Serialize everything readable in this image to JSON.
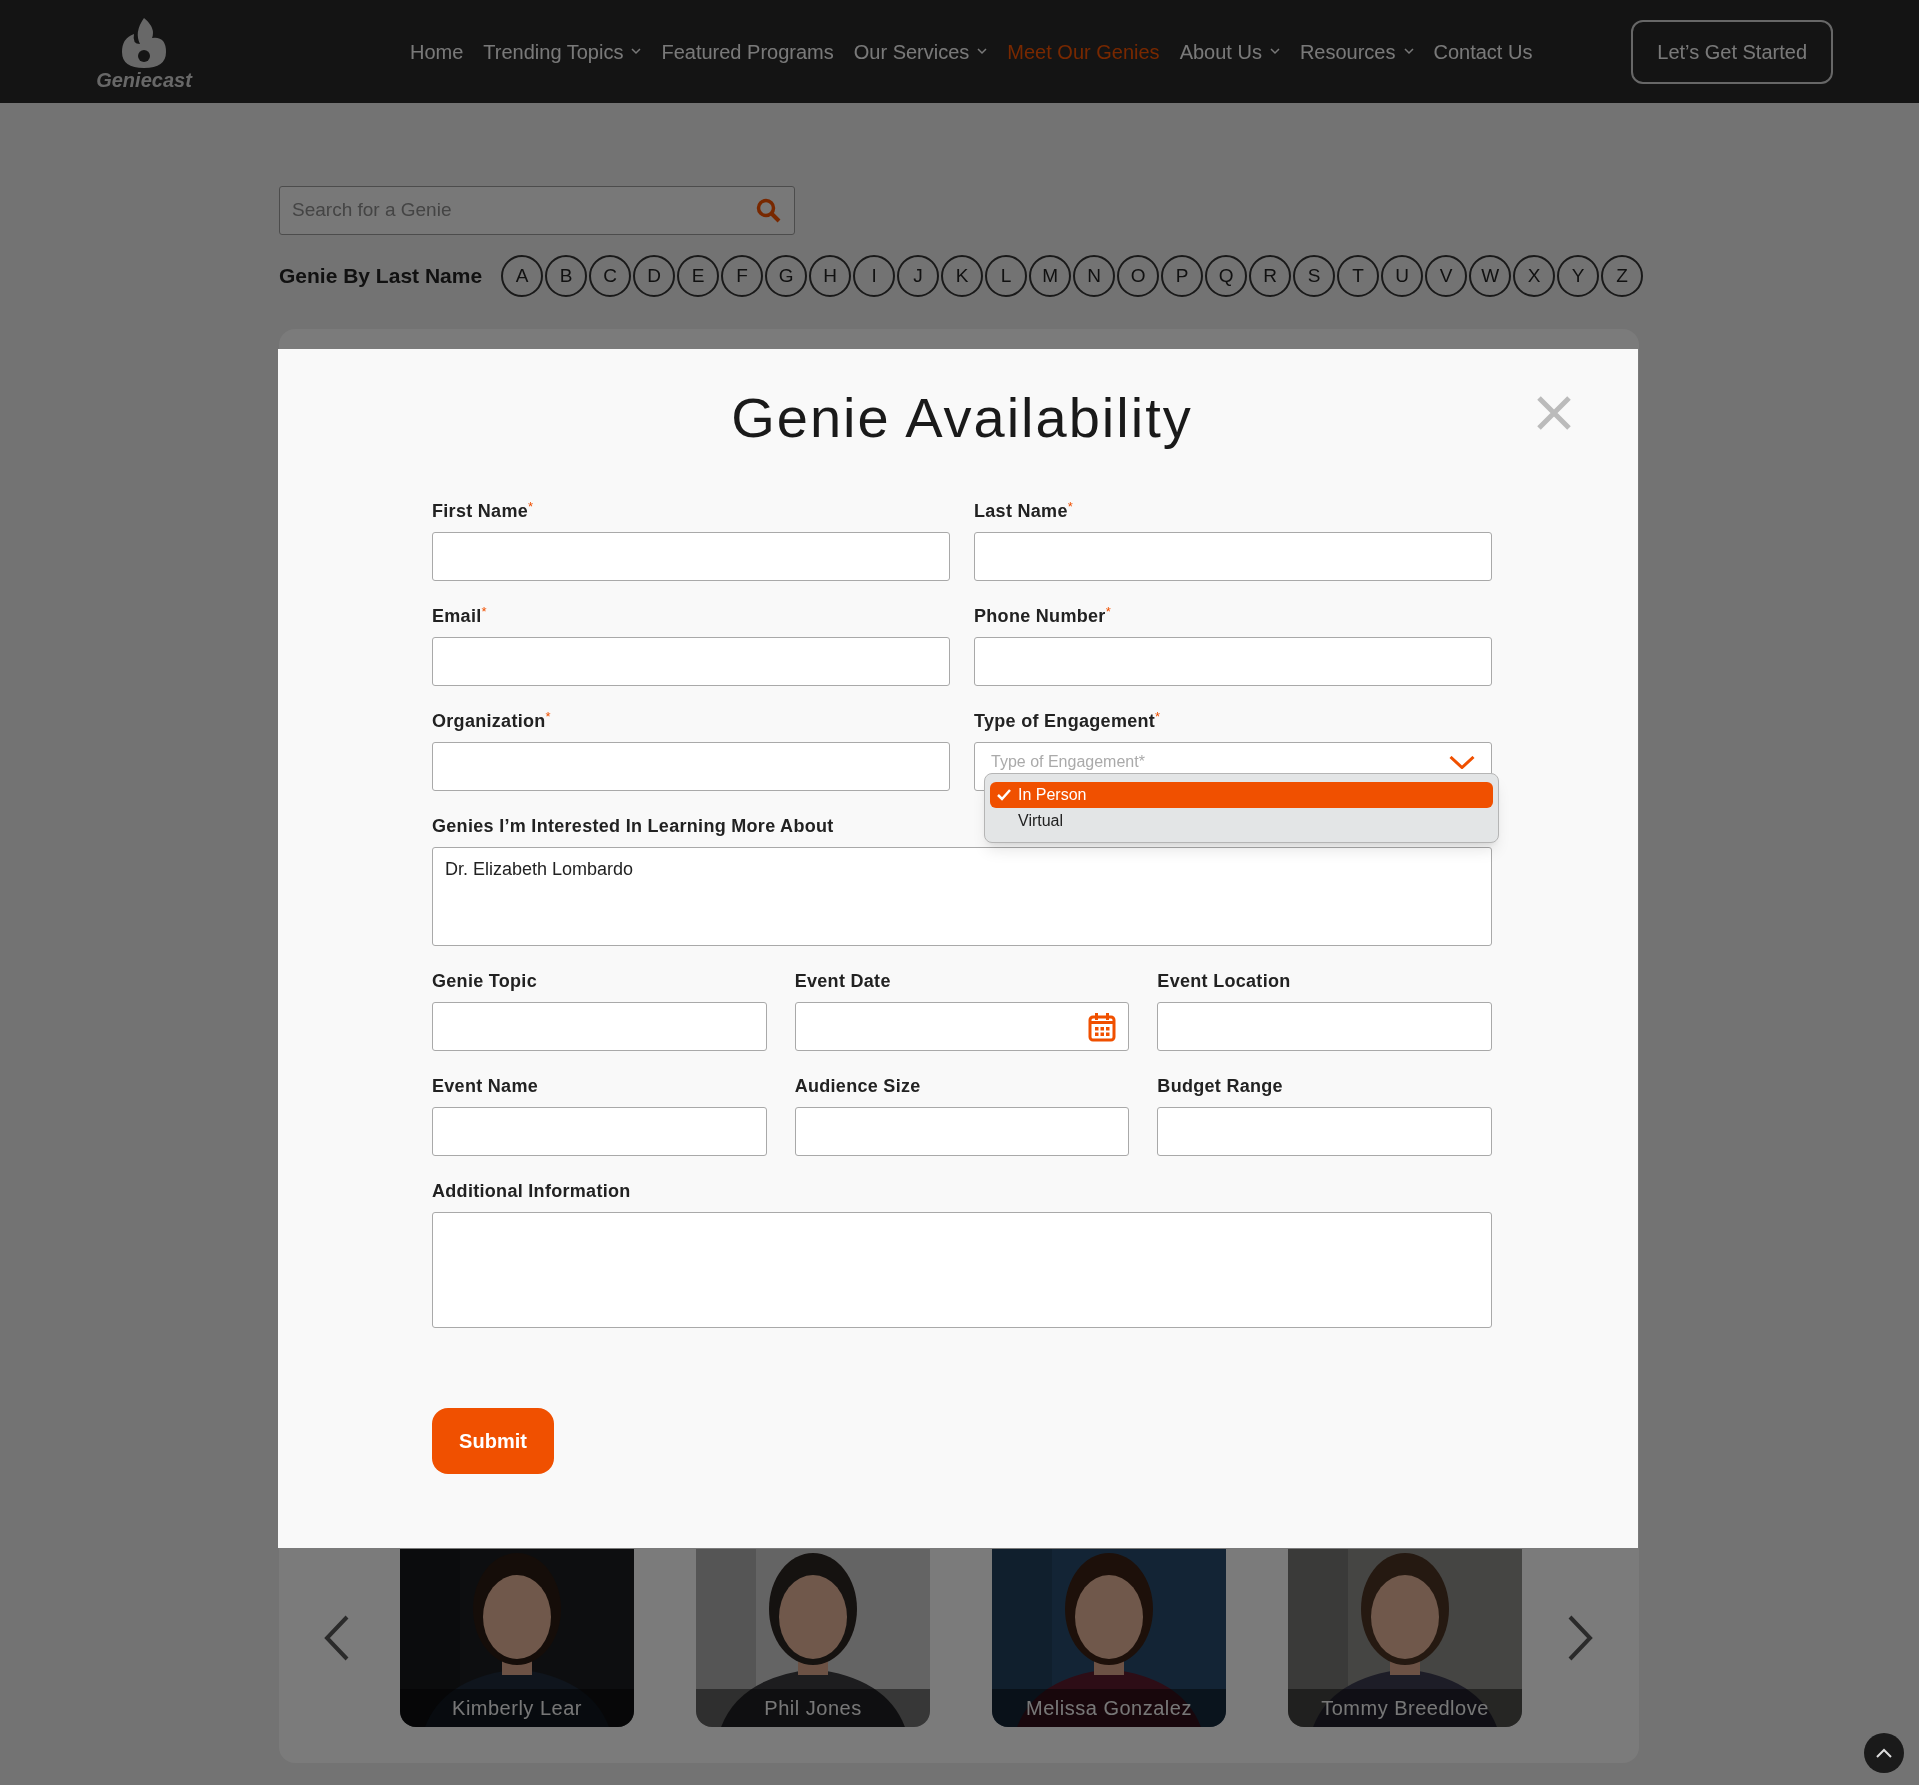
{
  "header": {
    "logo_text": "Geniecast",
    "nav": [
      {
        "label": "Home",
        "selected": false,
        "dropdown": false
      },
      {
        "label": "Trending Topics",
        "selected": false,
        "dropdown": true
      },
      {
        "label": "Featured Programs",
        "selected": false,
        "dropdown": false
      },
      {
        "label": "Our Services",
        "selected": false,
        "dropdown": true
      },
      {
        "label": "Meet Our Genies",
        "selected": true,
        "dropdown": false
      },
      {
        "label": "About Us",
        "selected": false,
        "dropdown": true
      },
      {
        "label": "Resources",
        "selected": false,
        "dropdown": true
      },
      {
        "label": "Contact Us",
        "selected": false,
        "dropdown": false
      }
    ],
    "cta": "Let’s Get Started"
  },
  "search": {
    "placeholder": "Search for a Genie"
  },
  "alphabet": {
    "label": "Genie By Last Name",
    "letters": [
      "A",
      "B",
      "C",
      "D",
      "E",
      "F",
      "G",
      "H",
      "I",
      "J",
      "K",
      "L",
      "M",
      "N",
      "O",
      "P",
      "Q",
      "R",
      "S",
      "T",
      "U",
      "V",
      "W",
      "X",
      "Y",
      "Z"
    ]
  },
  "modal": {
    "title": "Genie Availability",
    "rows": [
      [
        {
          "label": "First Name",
          "mark": "*",
          "kind": "text"
        },
        {
          "label": "Last Name",
          "mark": "*",
          "kind": "text"
        }
      ],
      [
        {
          "label": "Email",
          "mark": "*",
          "kind": "text"
        },
        {
          "label": "Phone Number",
          "mark": "*",
          "kind": "text"
        }
      ],
      [
        {
          "label": "Organization",
          "mark": "*",
          "kind": "text"
        },
        {
          "label": "Type of Engagement",
          "mark": "*",
          "kind": "select",
          "placeholder": "Type of Engagement*",
          "expanded": true,
          "options": [
            {
              "label": "In Person",
              "selected": true
            },
            {
              "label": "Virtual",
              "selected": false
            }
          ]
        }
      ],
      [
        {
          "label": "Genies I’m Interested In Learning More About",
          "kind": "textarea",
          "value": "Dr. Elizabeth Lombardo"
        }
      ],
      [
        {
          "label": "Genie Topic",
          "kind": "text"
        },
        {
          "label": "Event Date",
          "kind": "date"
        },
        {
          "label": "Event Location",
          "kind": "text"
        }
      ],
      [
        {
          "label": "Event Name",
          "kind": "text"
        },
        {
          "label": "Audience Size",
          "kind": "text"
        },
        {
          "label": "Budget Range",
          "kind": "text"
        }
      ],
      [
        {
          "label": "Additional Information",
          "kind": "textarea_large"
        }
      ]
    ],
    "submit": "Submit"
  },
  "carousel": {
    "genies": [
      {
        "name": "Kimberly Lear"
      },
      {
        "name": "Phil Jones"
      },
      {
        "name": "Melissa Gonzalez"
      },
      {
        "name": "Tommy Breedlove"
      }
    ]
  }
}
